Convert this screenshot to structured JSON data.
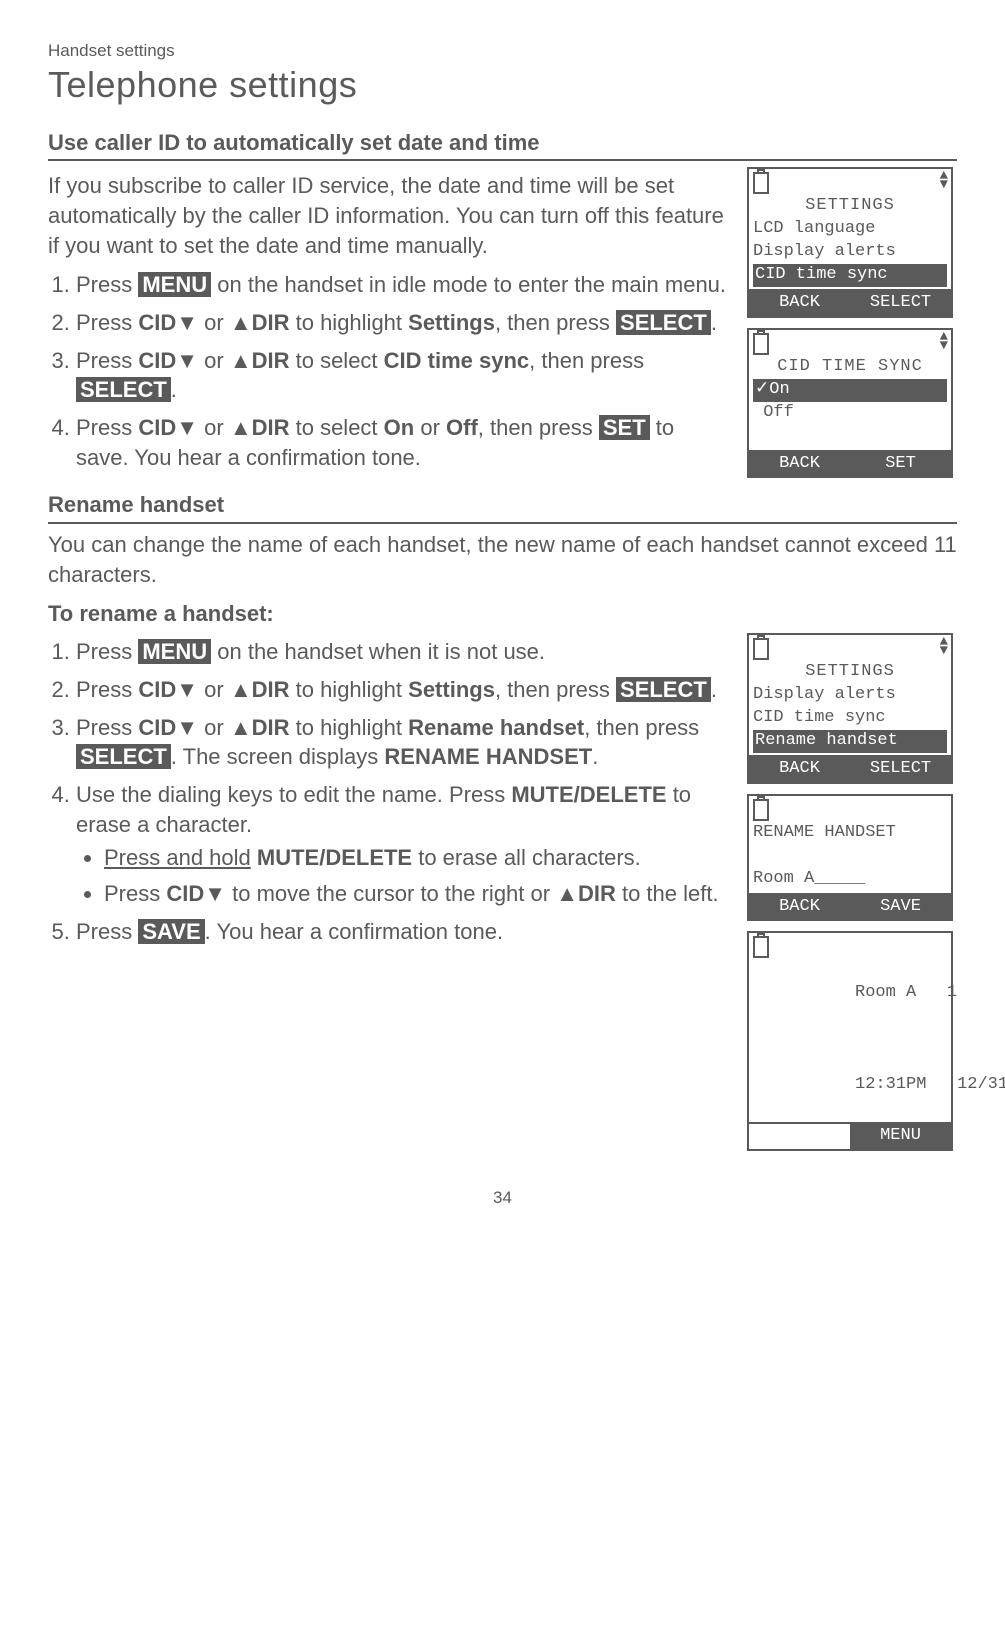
{
  "breadcrumb": "Handset settings",
  "page_title": "Telephone settings",
  "page_number": "34",
  "section1": {
    "heading": "Use caller ID to automatically set date and time",
    "intro": "If you subscribe to caller ID service, the date and time will be set automatically by the caller ID information. You can turn off this feature if you want to set the date and time manually.",
    "steps": {
      "s1_pre": "Press ",
      "s1_btn": "MENU",
      "s1_post": " on the handset in idle mode to enter the main menu.",
      "s2_a": "Press ",
      "s2_cid": "CID",
      "s2_or": " or ",
      "s2_dir": "DIR",
      "s2_mid": " to highlight ",
      "s2_target": "Settings",
      "s2_then": ", then press ",
      "s2_btn": "SELECT",
      "s2_end": ".",
      "s3_a": "Press ",
      "s3_cid": "CID",
      "s3_or": " or ",
      "s3_dir": "DIR",
      "s3_mid": " to select ",
      "s3_target": "CID time sync",
      "s3_then": ", then press ",
      "s3_btn": "SELECT",
      "s3_end": ".",
      "s4_a": "Press ",
      "s4_cid": "CID",
      "s4_or": " or ",
      "s4_dir": "DIR",
      "s4_mid": " to select ",
      "s4_on": "On",
      "s4_or2": " or ",
      "s4_off": "Off",
      "s4_then": ", then press ",
      "s4_btn": "SET",
      "s4_post": " to save. You hear a confirmation tone."
    },
    "lcd1": {
      "title": "SETTINGS",
      "line1": "LCD language",
      "line2": "Display alerts",
      "line3": "CID time sync",
      "sk_left": "BACK",
      "sk_right": "SELECT"
    },
    "lcd2": {
      "title": "CID TIME SYNC",
      "line1": "✓On",
      "line2": " Off",
      "sk_left": "BACK",
      "sk_right": "SET"
    }
  },
  "section2": {
    "heading": "Rename handset",
    "intro": "You can change the name of each handset, the new name of each handset cannot exceed 11 characters.",
    "subheading": "To rename a handset:",
    "steps": {
      "s1_pre": "Press ",
      "s1_btn": "MENU",
      "s1_post": " on the handset when it is not use.",
      "s2_a": "Press ",
      "s2_cid": "CID",
      "s2_or": " or ",
      "s2_dir": "DIR",
      "s2_mid": " to highlight ",
      "s2_target": "Settings",
      "s2_then": ", then press ",
      "s2_btn": "SELECT",
      "s2_end": ".",
      "s3_a": "Press ",
      "s3_cid": "CID",
      "s3_or": " or ",
      "s3_dir": "DIR",
      "s3_mid": " to highlight ",
      "s3_target": "Rename handset",
      "s3_then": ", then press ",
      "s3_btn": "SELECT",
      "s3_post": ". The screen displays ",
      "s3_disp": "RENAME HANDSET",
      "s3_end": ".",
      "s4_a": "Use the dialing keys to edit the name. Press ",
      "s4_key": "MUTE/DELETE",
      "s4_post": " to erase a character.",
      "b1_a": "Press and hold",
      "b1_key": " MUTE/DELETE",
      "b1_post": " to erase all characters.",
      "b2_a": "Press ",
      "b2_cid": "CID",
      "b2_mid": " to move the cursor to the right or ",
      "b2_dir": "DIR",
      "b2_post": " to the left.",
      "s5_a": "Press ",
      "s5_btn": "SAVE",
      "s5_post": ". You hear a confirmation tone."
    },
    "lcd1": {
      "title": "SETTINGS",
      "line1": "Display alerts",
      "line2": "CID time sync",
      "line3": "Rename handset",
      "sk_left": "BACK",
      "sk_right": "SELECT"
    },
    "lcd2": {
      "title": "RENAME HANDSET",
      "value": "Room A_____",
      "sk_left": "BACK",
      "sk_right": "SAVE"
    },
    "lcd3": {
      "name": "Room A",
      "num": "1",
      "time": "12:31PM",
      "date": "12/31",
      "sk_right": "MENU"
    }
  }
}
